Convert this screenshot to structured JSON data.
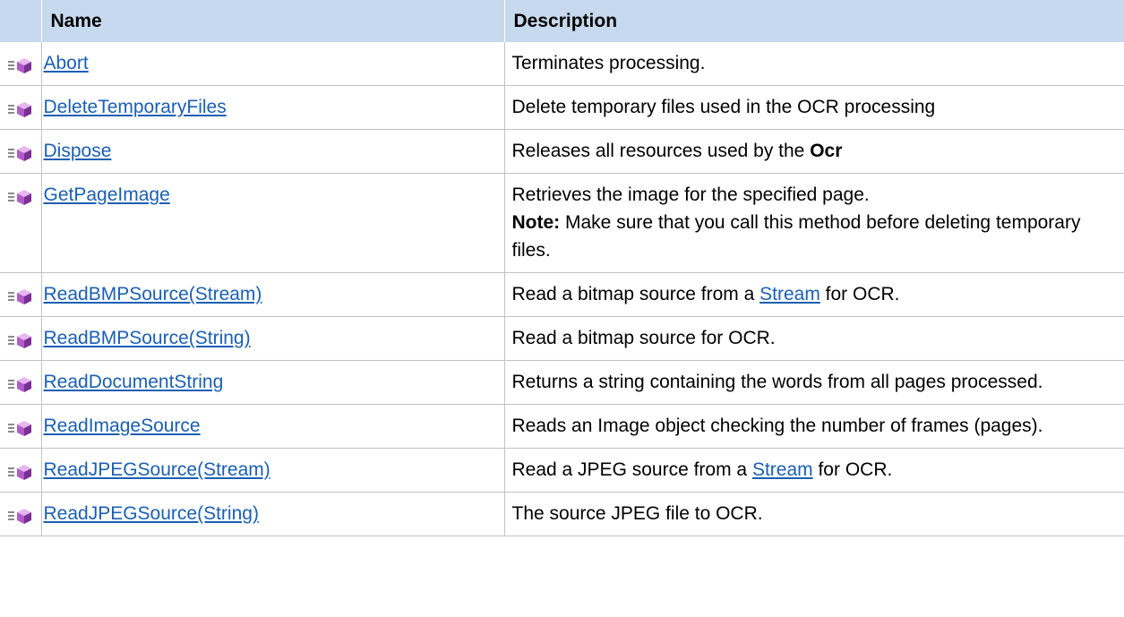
{
  "header": {
    "icon": "",
    "name": "Name",
    "description": "Description"
  },
  "icon": "public-method-icon",
  "rows": {
    "r0": {
      "name": "Abort",
      "desc": "Terminates processing."
    },
    "r1": {
      "name": "DeleteTemporaryFiles",
      "desc": "Delete temporary files used in the OCR processing"
    },
    "r2": {
      "name": "Dispose",
      "desc_pre": "Releases all resources used by the ",
      "desc_bold": "Ocr"
    },
    "r3": {
      "name": "GetPageImage",
      "desc": "Retrieves the image for the specified page.",
      "note_label": "Note:",
      "note_text": " Make sure that you call this method before deleting temporary files."
    },
    "r4": {
      "name": "ReadBMPSource(Stream)",
      "desc_pre": "Read a bitmap source from a ",
      "desc_link": "Stream",
      "desc_post": " for OCR."
    },
    "r5": {
      "name": "ReadBMPSource(String)",
      "desc": "Read a bitmap source for OCR."
    },
    "r6": {
      "name": "ReadDocumentString",
      "desc": "Returns a string containing the words from all pages processed."
    },
    "r7": {
      "name": "ReadImageSource",
      "desc": "Reads an Image object checking the number of frames (pages)."
    },
    "r8": {
      "name": "ReadJPEGSource(Stream)",
      "desc_pre": "Read a JPEG source from a ",
      "desc_link": "Stream",
      "desc_post": " for OCR."
    },
    "r9": {
      "name": "ReadJPEGSource(String)",
      "desc": "The source JPEG file to OCR."
    }
  }
}
